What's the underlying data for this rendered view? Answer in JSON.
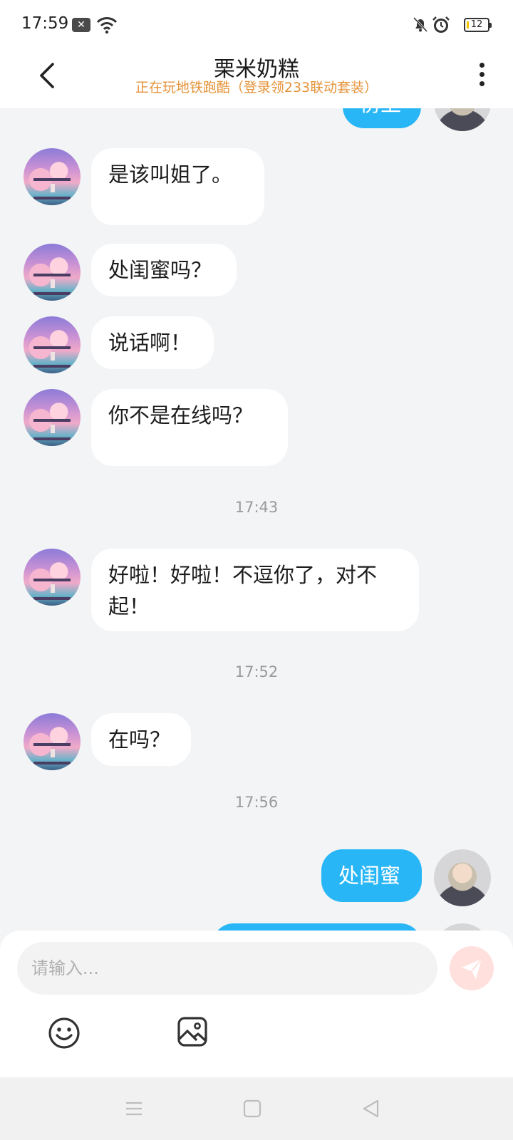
{
  "status_bar": {
    "time": "17:59",
    "notification_icon": "close-notification-icon",
    "battery": "12"
  },
  "header": {
    "title": "栗米奶糕",
    "subtitle": "正在玩地铁跑酷（登录领233联动套装）",
    "back_icon": "chevron-left-icon",
    "more_icon": "more-vertical-icon"
  },
  "colors": {
    "accent": "#29b6f6",
    "subtitle": "#e5933a",
    "send_inactive": "#ffe0dc"
  },
  "messages": [
    {
      "from": "self",
      "text": "傍上"
    },
    {
      "from": "other",
      "text": "是该叫姐了。"
    },
    {
      "from": "other",
      "text": "处闺蜜吗？"
    },
    {
      "from": "other",
      "text": "说话啊！"
    },
    {
      "from": "other",
      "text": "你不是在线吗？"
    },
    {
      "time": "17:43"
    },
    {
      "from": "other",
      "text": "好啦！好啦！不逗你了，对不起！"
    },
    {
      "time": "17:52"
    },
    {
      "from": "other",
      "text": "在吗？"
    },
    {
      "time": "17:56"
    },
    {
      "from": "self",
      "text": "处闺蜜"
    },
    {
      "from": "self",
      "text": ""
    }
  ],
  "input": {
    "placeholder": "请输入...",
    "value": ""
  },
  "toolbar": {
    "emoji_icon": "smiley-icon",
    "image_icon": "image-icon",
    "send_icon": "send-icon"
  },
  "nav": {
    "menu_icon": "menu-icon",
    "home_icon": "home-square-icon",
    "back_icon": "back-triangle-icon"
  }
}
